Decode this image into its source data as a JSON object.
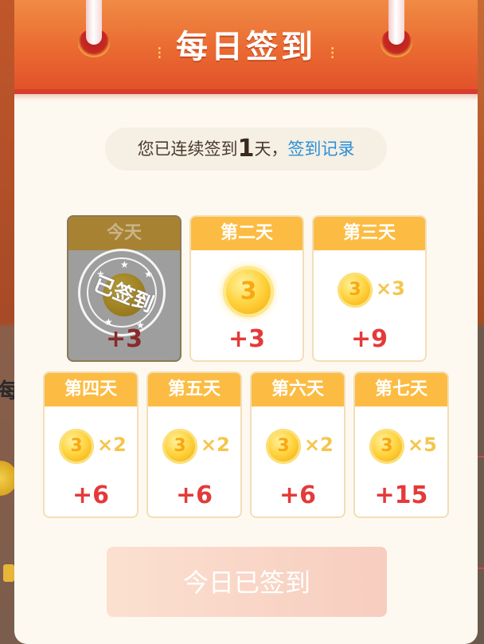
{
  "header": {
    "title": "每日签到"
  },
  "streak": {
    "prefix": "您已连续签到",
    "days": "1",
    "suffix": "天，",
    "link": "签到记录"
  },
  "days": [
    {
      "label": "今天",
      "points": "+3",
      "coins": "3",
      "status": "已签到"
    },
    {
      "label": "第二天",
      "points": "+3",
      "coins": "3"
    },
    {
      "label": "第三天",
      "points": "+9",
      "coins": "3",
      "multiplier": "×3"
    },
    {
      "label": "第四天",
      "points": "+6",
      "coins": "3",
      "multiplier": "×2"
    },
    {
      "label": "第五天",
      "points": "+6",
      "coins": "3",
      "multiplier": "×2"
    },
    {
      "label": "第六天",
      "points": "+6",
      "coins": "3",
      "multiplier": "×2"
    },
    {
      "label": "第七天",
      "points": "+15",
      "coins": "3",
      "multiplier": "×5"
    }
  ],
  "button": {
    "label": "今日已签到"
  },
  "background": {
    "left_glyph": "每"
  },
  "colors": {
    "accent": "#fcbc43",
    "points": "#e43a3a",
    "link": "#2a8fd6",
    "header": "#ea6a32"
  }
}
